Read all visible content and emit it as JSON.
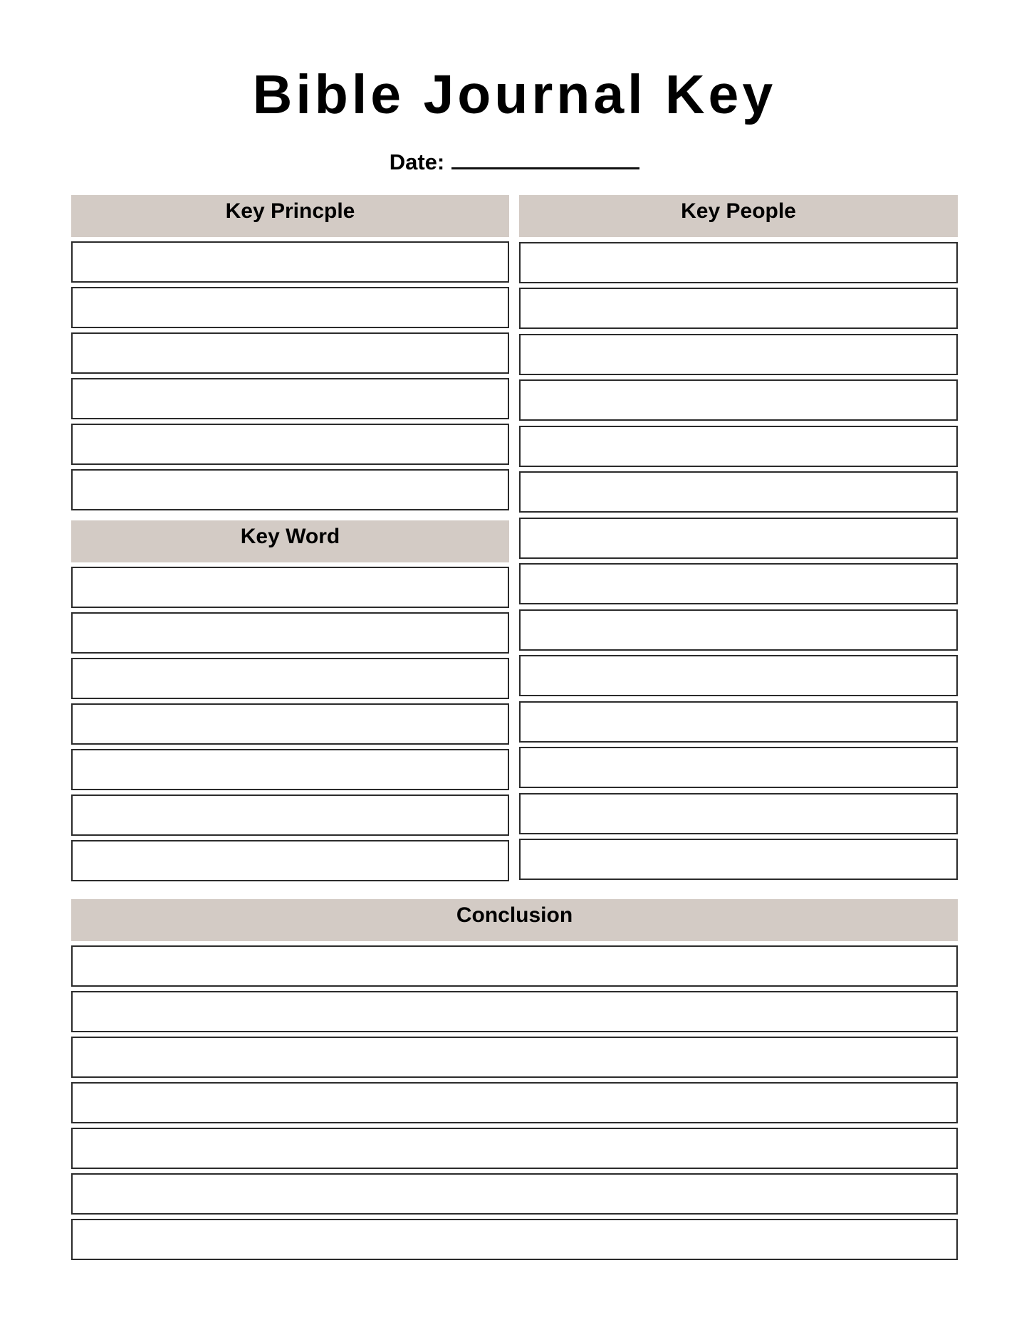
{
  "page": {
    "title": "Bible Journal Key",
    "date_label": "Date:",
    "date_value": ""
  },
  "sections": {
    "key_principle": {
      "label": "Key Princple",
      "rows": 6
    },
    "key_word": {
      "label": "Key Word",
      "rows": 7
    },
    "key_people": {
      "label": "Key People",
      "rows": 14
    },
    "conclusion": {
      "label": "Conclusion",
      "rows": 7
    }
  },
  "colors": {
    "header_fill": "#d3cbc5",
    "box_border": "#2b2b2b"
  }
}
